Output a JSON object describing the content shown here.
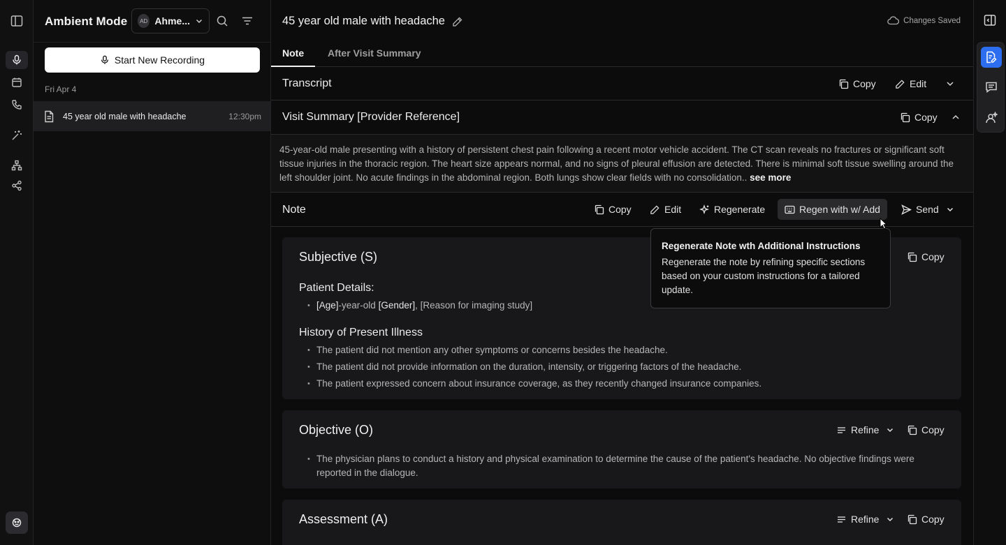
{
  "sidebar": {
    "title": "Ambient Mode",
    "user_initials": "AD",
    "user_name": "Ahme...",
    "new_recording_label": "Start New Recording",
    "date_group": "Fri Apr 4",
    "sessions": [
      {
        "title": "45 year old male with headache",
        "time": "12:30pm"
      }
    ]
  },
  "main": {
    "title": "45 year old male with headache",
    "save_status": "Changes Saved",
    "tabs": [
      "Note",
      "After Visit Summary"
    ],
    "transcript": {
      "title": "Transcript",
      "copy": "Copy",
      "edit": "Edit"
    },
    "visit_summary": {
      "title": "Visit Summary [Provider Reference]",
      "copy": "Copy",
      "text": "45-year-old male presenting with a history of persistent chest pain following a recent motor vehicle accident. The CT scan reveals no fractures or significant soft tissue injuries in the thoracic region. The heart size appears normal, and no signs of pleural effusion are detected. There is minimal soft tissue swelling around the left shoulder joint. No acute findings in the abdominal region. Both lungs show clear fields with no consolidation..",
      "see_more": " see more"
    },
    "note": {
      "title": "Note",
      "copy": "Copy",
      "edit": "Edit",
      "regenerate": "Regenerate",
      "regen_add": "Regen with w/ Add",
      "send": "Send"
    },
    "sections": {
      "subjective": {
        "title": "Subjective (S)",
        "copy": "Copy",
        "patient_details_heading": "Patient Details:",
        "patient_line": {
          "age": "[Age]",
          "mid": "-year-old ",
          "gender": "[Gender]",
          "rest": ", [Reason for imaging study]"
        },
        "hpi_heading": "History of Present Illness",
        "hpi_items": [
          "The patient did not mention any other symptoms or concerns besides the headache.",
          "The patient did not provide information on the duration, intensity, or triggering factors of the headache.",
          "The patient expressed concern about insurance coverage, as they recently changed insurance companies."
        ]
      },
      "objective": {
        "title": "Objective (O)",
        "refine": "Refine",
        "copy": "Copy",
        "items": [
          "The physician plans to conduct a history and physical examination to determine the cause of the patient's headache. No objective findings were reported in the dialogue."
        ]
      },
      "assessment": {
        "title": "Assessment (A)",
        "refine": "Refine",
        "copy": "Copy"
      }
    }
  },
  "tooltip": {
    "title": "Regenerate Note wth Additional Instructions",
    "body": "Regenerate the note by refining specific sections based on your custom instructions for a tailored update."
  },
  "colors": {
    "accent": "#2d6ef0",
    "background": "#0c0c0d",
    "card": "#18181a"
  }
}
